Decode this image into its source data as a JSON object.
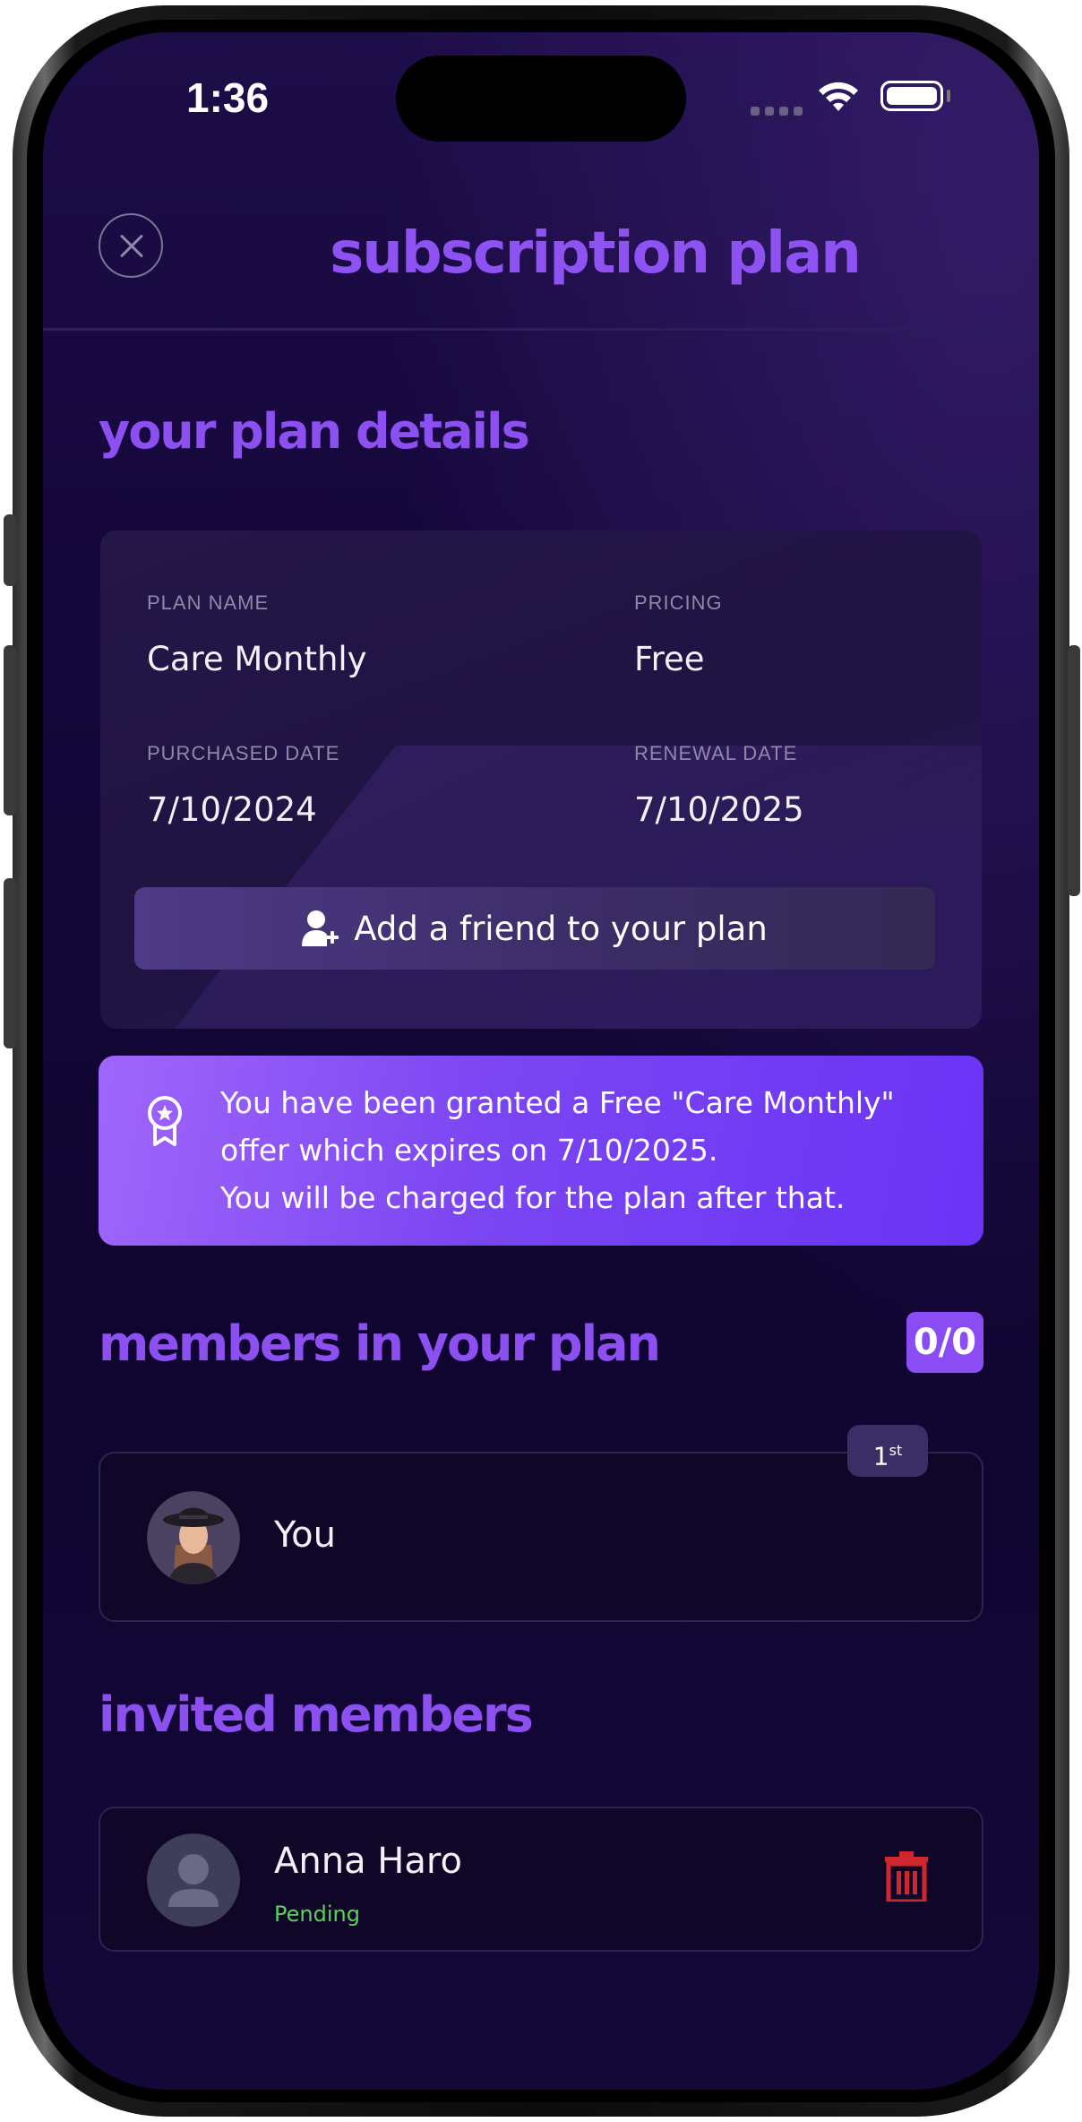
{
  "status_bar": {
    "time": "1:36"
  },
  "header": {
    "title": "subscription plan"
  },
  "plan_details": {
    "section_title": "your plan details",
    "fields": [
      {
        "label": "PLAN NAME",
        "value": "Care Monthly"
      },
      {
        "label": "PRICING",
        "value": "Free"
      },
      {
        "label": "PURCHASED DATE",
        "value": "7/10/2024"
      },
      {
        "label": "RENEWAL DATE",
        "value": "7/10/2025"
      }
    ],
    "add_friend_label": "Add a friend to your plan"
  },
  "offer": {
    "lines": [
      "You have been granted a Free \"Care Monthly\"",
      "offer which expires on 7/10/2025.",
      "You will be charged for the plan after that."
    ]
  },
  "members": {
    "section_title": "members in your plan",
    "count": "0/0",
    "list": [
      {
        "name": "You",
        "rank": "1",
        "rank_suffix": "st"
      }
    ]
  },
  "invited": {
    "section_title": "invited members",
    "list": [
      {
        "name": "Anna Haro",
        "status": "Pending"
      }
    ]
  },
  "colors": {
    "accent": "#8c50f0",
    "background": "#14073a",
    "pending": "#5bd15b",
    "delete": "#d0262e"
  },
  "icons": [
    "close-icon",
    "wifi-icon",
    "battery-icon",
    "add-person-icon",
    "award-icon",
    "avatar-placeholder-icon",
    "trash-icon"
  ]
}
